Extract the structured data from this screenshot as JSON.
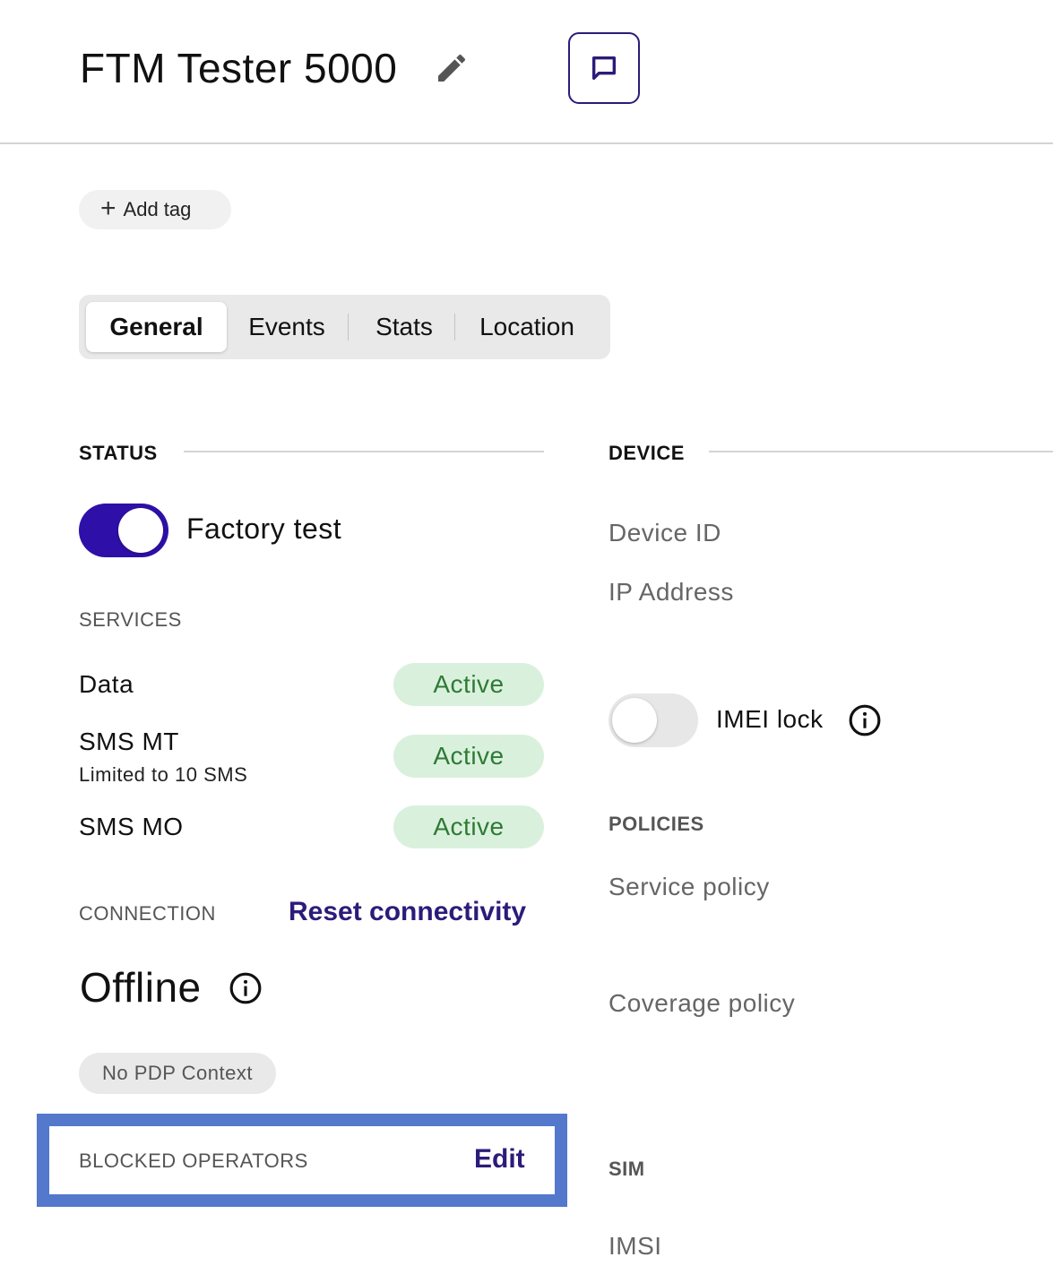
{
  "header": {
    "title": "FTM Tester 5000",
    "edit_icon": "pencil-icon",
    "message_icon": "message-square-icon"
  },
  "tags": {
    "add_label": "Add tag",
    "add_icon": "plus"
  },
  "tabs": [
    {
      "label": "General",
      "active": true
    },
    {
      "label": "Events",
      "active": false
    },
    {
      "label": "Stats",
      "active": false
    },
    {
      "label": "Location",
      "active": false
    }
  ],
  "status": {
    "heading": "STATUS",
    "factory_test": {
      "label": "Factory test",
      "enabled": true
    },
    "services_heading": "SERVICES",
    "services": [
      {
        "name": "Data",
        "note": "",
        "status": "Active"
      },
      {
        "name": "SMS MT",
        "note": "Limited to 10 SMS",
        "status": "Active"
      },
      {
        "name": "SMS MO",
        "note": "",
        "status": "Active"
      }
    ],
    "connection_heading": "CONNECTION",
    "reset_label": "Reset connectivity",
    "connection_state": "Offline",
    "pdp_label": "No PDP Context",
    "blocked_heading": "BLOCKED OPERATORS",
    "blocked_edit_label": "Edit"
  },
  "device": {
    "heading": "DEVICE",
    "device_id_label": "Device ID",
    "ip_label": "IP Address",
    "imei_lock": {
      "label": "IMEI lock",
      "enabled": false
    },
    "policies_heading": "POLICIES",
    "service_policy_label": "Service policy",
    "coverage_policy_label": "Coverage policy",
    "sim_heading": "SIM",
    "imsi_label": "IMSI"
  },
  "colors": {
    "accent": "#2e0fa8",
    "link": "#2d1b7a",
    "active_bg": "#d9f1dc",
    "active_text": "#2f7a36",
    "highlight": "#5378cc"
  }
}
